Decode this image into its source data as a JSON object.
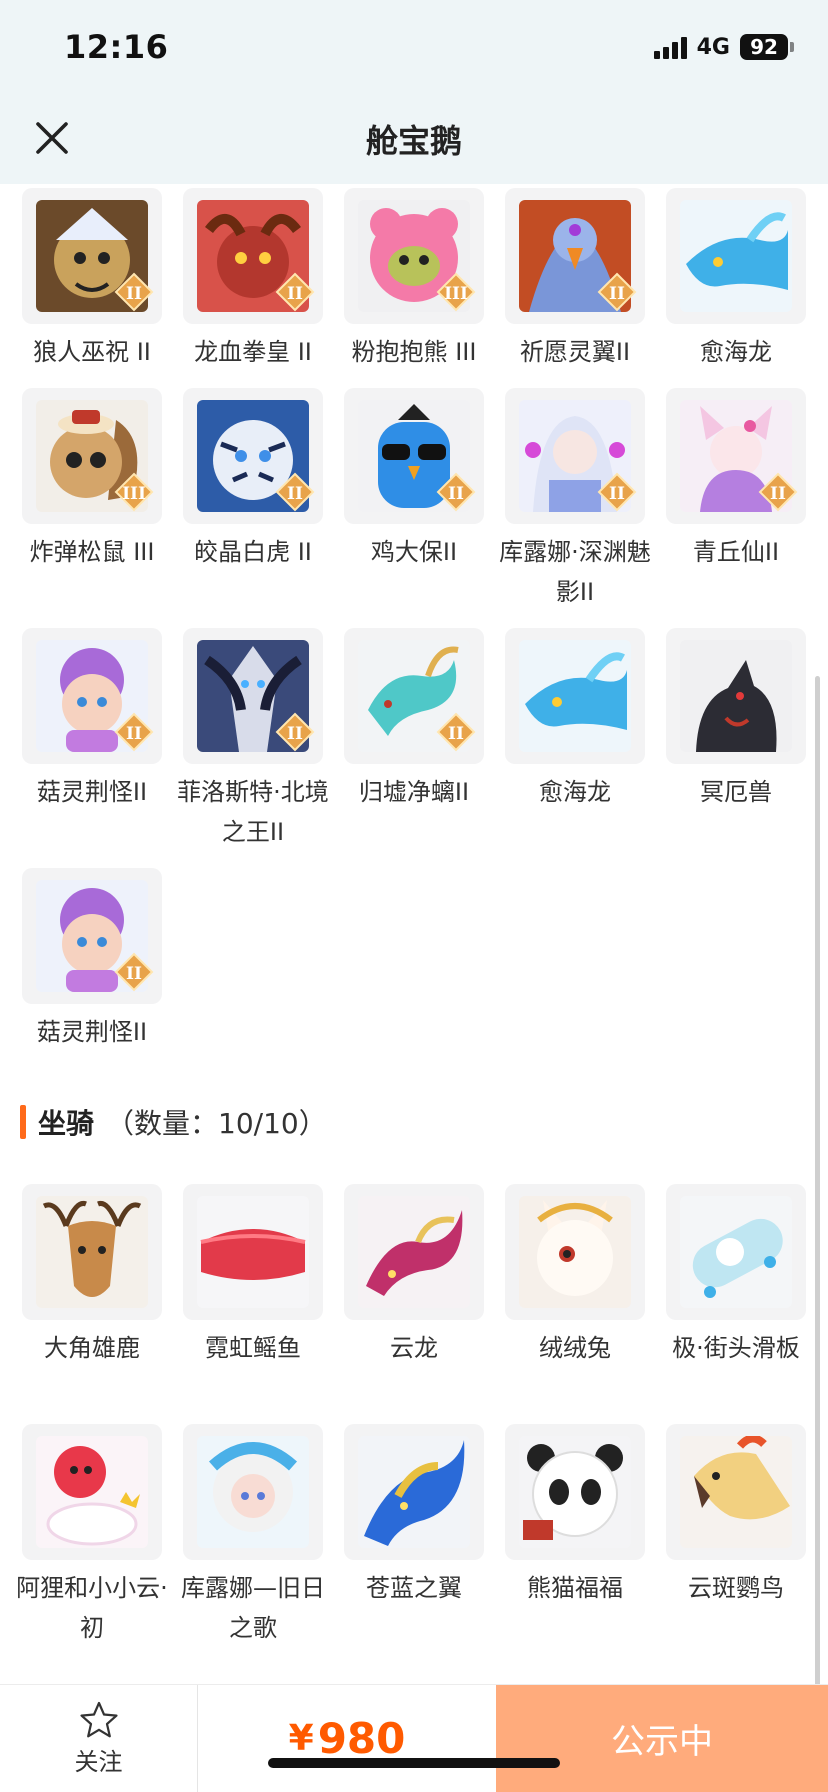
{
  "status_bar": {
    "time": "12:16",
    "network": "4G",
    "battery": "92"
  },
  "header": {
    "title": "舱宝鹅"
  },
  "pets": [
    {
      "name": "狼人巫祝 II",
      "icon": "werewolf-icon",
      "tier": "II"
    },
    {
      "name": "龙血拳皇 II",
      "icon": "dragon-fighter-icon",
      "tier": "II"
    },
    {
      "name": "粉抱抱熊 III",
      "icon": "pink-bear-icon",
      "tier": "III"
    },
    {
      "name": "祈愿灵翼II",
      "icon": "eagle-icon",
      "tier": "II"
    },
    {
      "name": "愈海龙",
      "icon": "sea-dragon-icon",
      "tier": ""
    },
    {
      "name": "炸弹松鼠 III",
      "icon": "squirrel-icon",
      "tier": "III"
    },
    {
      "name": "皎晶白虎 II",
      "icon": "white-tiger-icon",
      "tier": "II"
    },
    {
      "name": "鸡大保II",
      "icon": "blue-chicken-icon",
      "tier": "II"
    },
    {
      "name": "库露娜·深渊魅影II",
      "icon": "kuluna-icon",
      "tier": "II"
    },
    {
      "name": "青丘仙II",
      "icon": "fox-fairy-icon",
      "tier": "II"
    },
    {
      "name": "菇灵荆怪II",
      "icon": "mushroom-icon",
      "tier": "II"
    },
    {
      "name": "菲洛斯特·北境之王II",
      "icon": "frost-king-icon",
      "tier": "II"
    },
    {
      "name": "归墟净螭II",
      "icon": "jade-dragon-icon",
      "tier": "II"
    },
    {
      "name": "愈海龙",
      "icon": "sea-dragon-icon",
      "tier": ""
    },
    {
      "name": "冥厄兽",
      "icon": "dark-beast-icon",
      "tier": ""
    },
    {
      "name": "菇灵荆怪II",
      "icon": "mushroom-icon",
      "tier": "II"
    }
  ],
  "mount_section": {
    "title": "坐骑",
    "count": "（数量：10/10）"
  },
  "mounts": [
    {
      "name": "大角雄鹿",
      "icon": "stag-icon"
    },
    {
      "name": "霓虹鳐鱼",
      "icon": "manta-ray-icon"
    },
    {
      "name": "云龙",
      "icon": "cloud-dragon-icon"
    },
    {
      "name": "绒绒兔",
      "icon": "rabbit-icon"
    },
    {
      "name": "极·街头滑板",
      "icon": "skateboard-icon"
    },
    {
      "name": "阿狸和小小云·初",
      "icon": "ali-fox-icon"
    },
    {
      "name": "库露娜—旧日之歌",
      "icon": "kuluna-song-icon"
    },
    {
      "name": "苍蓝之翼",
      "icon": "azure-wing-icon"
    },
    {
      "name": "熊猫福福",
      "icon": "panda-icon"
    },
    {
      "name": "云斑鹦鸟",
      "icon": "parrot-icon"
    }
  ],
  "bottom_bar": {
    "follow_label": "关注",
    "price_symbol": "¥",
    "price": "980",
    "status_button": "公示中"
  }
}
